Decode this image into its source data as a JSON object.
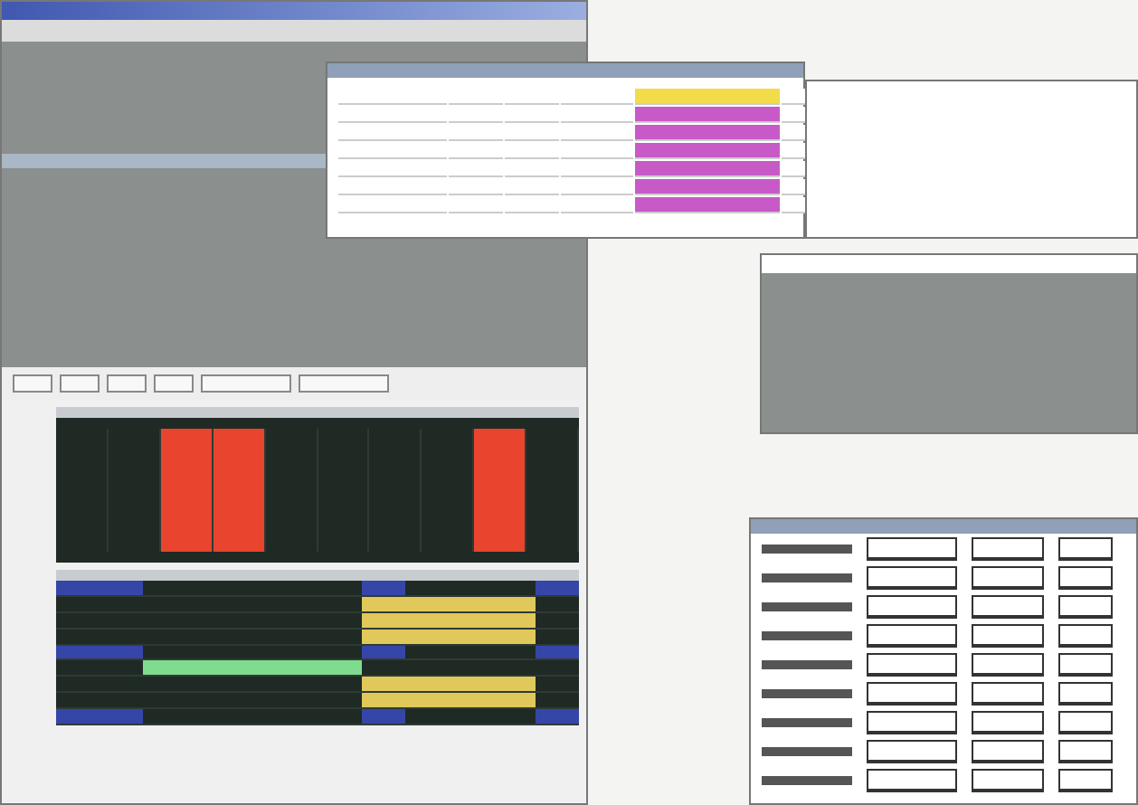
{
  "timeline_top": {
    "columns": [
      {
        "kind": "empty"
      },
      {
        "kind": "empty"
      },
      {
        "kind": "blocked"
      },
      {
        "kind": "blocked"
      },
      {
        "kind": "empty"
      },
      {
        "kind": "empty"
      },
      {
        "kind": "empty"
      },
      {
        "kind": "empty"
      },
      {
        "kind": "blocked"
      },
      {
        "kind": "empty"
      }
    ]
  },
  "timeline_bottom": {
    "rows": [
      {
        "kind": "marker"
      },
      {
        "kind": "booked"
      },
      {
        "kind": "booked"
      },
      {
        "kind": "booked"
      },
      {
        "kind": "marker"
      },
      {
        "kind": "green"
      },
      {
        "kind": "booked"
      },
      {
        "kind": "booked"
      },
      {
        "kind": "marker"
      }
    ]
  },
  "popup_table": {
    "rows": [
      {
        "kind": "first"
      },
      {
        "kind": "row"
      },
      {
        "kind": "row"
      },
      {
        "kind": "row"
      },
      {
        "kind": "row"
      },
      {
        "kind": "row"
      },
      {
        "kind": "row"
      }
    ]
  },
  "form": {
    "rows": [
      {
        "kind": "field-row"
      },
      {
        "kind": "field-row"
      },
      {
        "kind": "field-row"
      },
      {
        "kind": "field-row"
      },
      {
        "kind": "field-row"
      },
      {
        "kind": "field-row"
      },
      {
        "kind": "field-row"
      },
      {
        "kind": "field-row"
      },
      {
        "kind": "field-row"
      }
    ]
  }
}
